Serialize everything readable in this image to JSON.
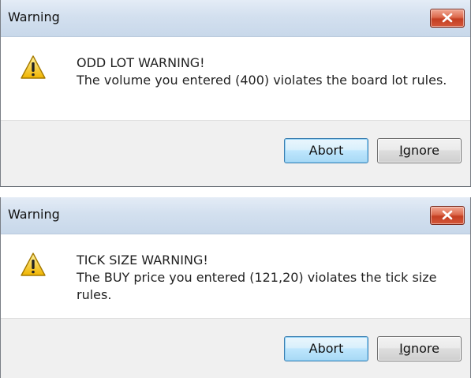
{
  "dialogs": [
    {
      "title": "Warning",
      "icon": "warning-icon",
      "heading": "ODD LOT WARNING!",
      "message": "The volume you entered (400) violates the board lot rules.",
      "buttons": {
        "abort": "Abort",
        "ignore_accel": "I",
        "ignore_rest": "gnore"
      }
    },
    {
      "title": "Warning",
      "icon": "warning-icon",
      "heading": "TICK SIZE WARNING!",
      "message": "The BUY price you entered (121,20) violates the tick size rules.",
      "buttons": {
        "abort": "Abort",
        "ignore_accel": "I",
        "ignore_rest": "gnore"
      }
    }
  ],
  "colors": {
    "close_button": "#d4573b",
    "warning_icon": "#f5c400",
    "default_button_border": "#3c7fb1"
  }
}
